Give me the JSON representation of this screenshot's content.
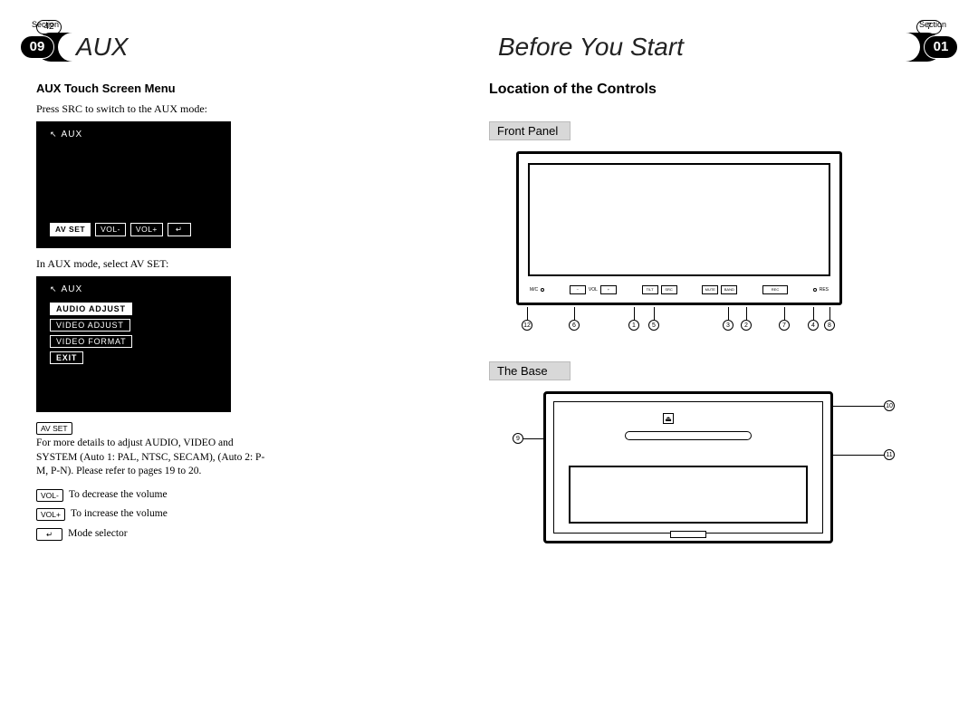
{
  "left": {
    "section_label": "Section",
    "section_number": "09",
    "title": "AUX",
    "page_number": "42",
    "subheading": "AUX Touch Screen Menu",
    "instr1": "Press SRC to switch to the AUX mode:",
    "screen1": {
      "label": "AUX",
      "buttons": [
        "AV SET",
        "VOL-",
        "VOL+",
        "↵"
      ]
    },
    "instr2": "In AUX mode, select AV SET:",
    "screen2": {
      "label": "AUX",
      "menu": [
        "AUDIO ADJUST",
        "VIDEO ADJUST",
        "VIDEO FORMAT",
        "EXIT"
      ]
    },
    "notes": {
      "avset": {
        "badge": "AV SET",
        "text": "For more details to adjust AUDIO, VIDEO and SYSTEM (Auto 1: PAL, NTSC, SECAM), (Auto 2: P-M, P-N). Please refer to pages 19 to 20."
      },
      "voldown": {
        "badge": "VOL-",
        "text": "To decrease the volume"
      },
      "volup": {
        "badge": "VOL+",
        "text": "To increase the volume"
      },
      "mode": {
        "badge": "↵",
        "text": "Mode selector"
      }
    }
  },
  "right": {
    "section_label": "Section",
    "section_number": "01",
    "title": "Before You Start",
    "page_number": "7",
    "heading": "Location of the Controls",
    "front_label": "Front Panel",
    "base_label": "The Base",
    "front_tiny": {
      "mic": "M/C",
      "vol": "VOL",
      "tilt": "TILT",
      "src": "SRC",
      "mute": "MUTE",
      "band": "BAND",
      "rec": "REC",
      "res": "RES"
    },
    "front_callouts": [
      "12",
      "6",
      "1",
      "5",
      "3",
      "2",
      "7",
      "4",
      "8"
    ],
    "base_callouts": {
      "left": "9",
      "topright": "10",
      "right": "11"
    }
  }
}
